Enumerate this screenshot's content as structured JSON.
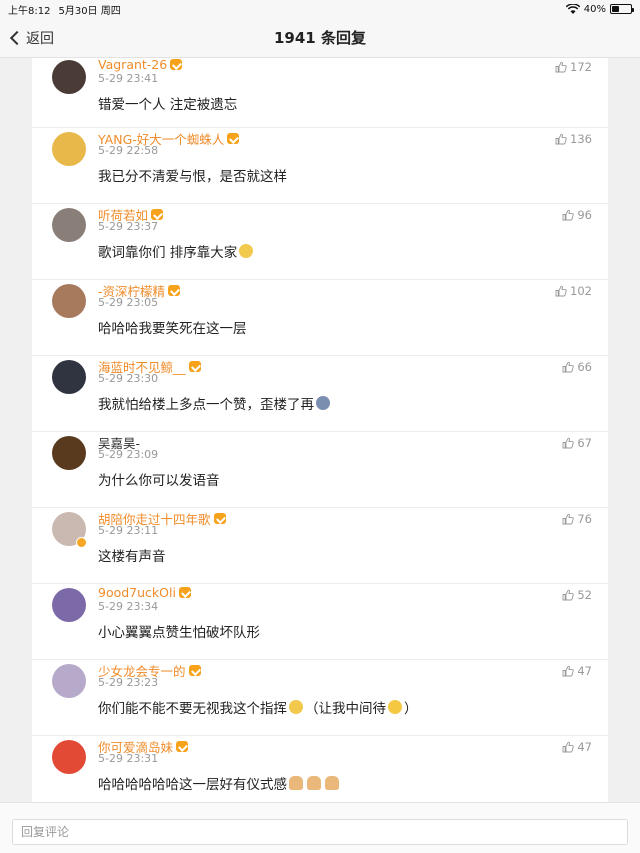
{
  "status": {
    "time": "上午8:12",
    "date": "5月30日 周四",
    "battery": "40%",
    "battery_level": 0.4
  },
  "nav": {
    "back_label": "返回",
    "title": "1941 条回复"
  },
  "comments": [
    {
      "user": "Vagrant-26",
      "vip": true,
      "time": "5-29 23:41",
      "text": "错爱一个人 注定被遗忘",
      "likes": "172",
      "avatar_color": "#4a3b36"
    },
    {
      "user": "YANG-好大一个蜘蛛人",
      "vip": true,
      "time": "5-29 22:58",
      "text": "我已分不清爱与恨，是否就这样",
      "likes": "136",
      "avatar_color": "#e8b84a"
    },
    {
      "user": "听荷若如",
      "vip": true,
      "time": "5-29 23:37",
      "text": "歌词靠你们 排序靠大家",
      "likes": "96",
      "avatar_color": "#8a7f78"
    },
    {
      "user": "-资深柠檬精",
      "vip": true,
      "time": "5-29 23:05",
      "text": "哈哈哈我要笑死在这一层",
      "likes": "102",
      "avatar_color": "#a77a5e"
    },
    {
      "user": "海蓝时不见鲸__",
      "vip": true,
      "time": "5-29 23:30",
      "text": "我就怕给楼上多点一个赞，歪楼了再",
      "likes": "66",
      "avatar_color": "#2f3440"
    },
    {
      "user": "吴嘉昊-",
      "vip": false,
      "time": "5-29 23:09",
      "text": "为什么你可以发语音",
      "likes": "67",
      "avatar_color": "#5a3a1e"
    },
    {
      "user": "胡陪你走过十四年歌",
      "vip": true,
      "time": "5-29 23:11",
      "text": "这楼有声音",
      "likes": "76",
      "avatar_color": "#c9b9b0"
    },
    {
      "user": "9ood7uckOli",
      "vip": true,
      "time": "5-29 23:34",
      "text": "小心翼翼点赞生怕破坏队形",
      "likes": "52",
      "avatar_color": "#7c6aa8"
    },
    {
      "user": "少女龙会专一的",
      "vip": true,
      "time": "5-29 23:23",
      "text": "你们能不能不要无视我这个指挥",
      "text2": "（让我中间待",
      "text3": "）",
      "likes": "47",
      "avatar_color": "#b7a9c9"
    },
    {
      "user": "你可爱滴岛妹",
      "vip": true,
      "time": "5-29 23:31",
      "text": "哈哈哈哈哈哈这一层好有仪式感",
      "likes": "47",
      "avatar_color": "#e34a36"
    }
  ],
  "input": {
    "placeholder": "回复评论"
  },
  "colors": {
    "username": "#f08c2a",
    "vip_badge": "#f7a21b",
    "meta": "#999999"
  }
}
